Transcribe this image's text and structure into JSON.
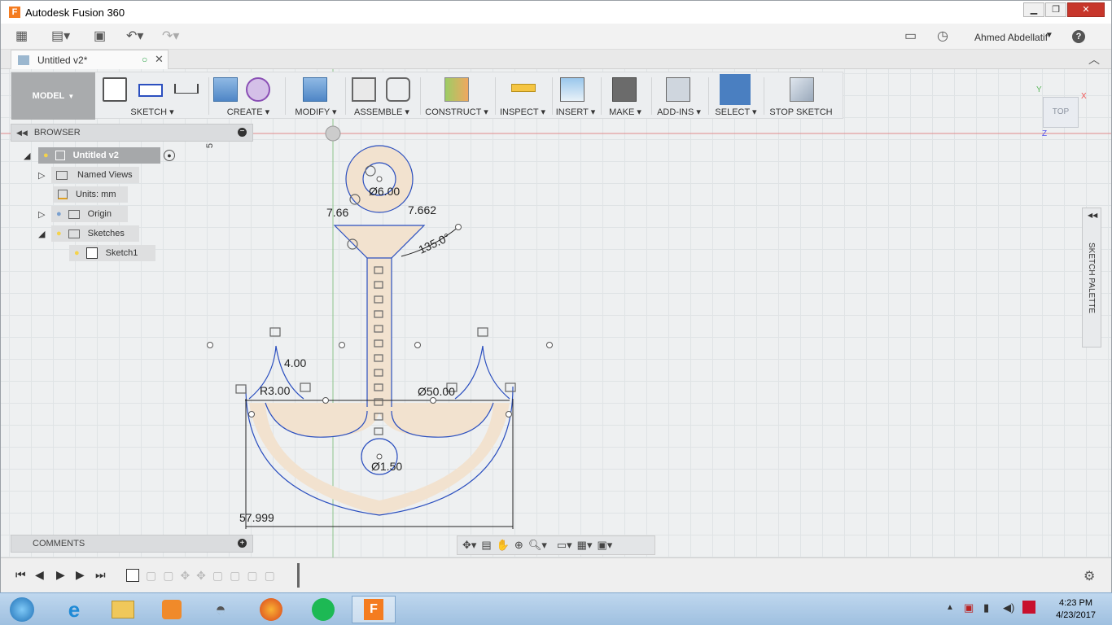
{
  "window": {
    "title": "Autodesk Fusion 360",
    "app_letter": "F",
    "min": "▁",
    "max": "❐",
    "close": "✕"
  },
  "appbar": {
    "user": "Ahmed Abdellatif",
    "help": "?"
  },
  "doc_tab": {
    "title": "Untitled v2*"
  },
  "toolbar": {
    "workspace": "MODEL",
    "groups": [
      "SKETCH",
      "CREATE",
      "MODIFY",
      "ASSEMBLE",
      "CONSTRUCT",
      "INSPECT",
      "INSERT",
      "MAKE",
      "ADD-INS",
      "SELECT",
      "STOP SKETCH"
    ]
  },
  "browser": {
    "title": "BROWSER",
    "root": "Untitled v2",
    "items": [
      "Named Views",
      "Units: mm",
      "Origin",
      "Sketches",
      "Sketch1"
    ]
  },
  "comments": {
    "title": "COMMENTS"
  },
  "viewcube": {
    "face": "TOP",
    "x": "X",
    "y": "Y",
    "z": "Z"
  },
  "palette": {
    "title": "SKETCH PALETTE"
  },
  "dimensions": {
    "d1": "Ø6.00",
    "d2": "7.662",
    "d3": "7.66",
    "d4": "135.0°",
    "d5": "4.00",
    "d6": "Ø50.00",
    "d7": "R3.00",
    "d8": "Ø1.50",
    "d9": "57.999",
    "d10": "5"
  },
  "taskbar": {
    "time": "4:23 PM",
    "date": "4/23/2017"
  },
  "colors": {
    "sketch_line": "#2b4fbf",
    "profile_fill": "#f2e2cf",
    "select_active": "#4a7fc1",
    "accent": "#f47c20"
  }
}
